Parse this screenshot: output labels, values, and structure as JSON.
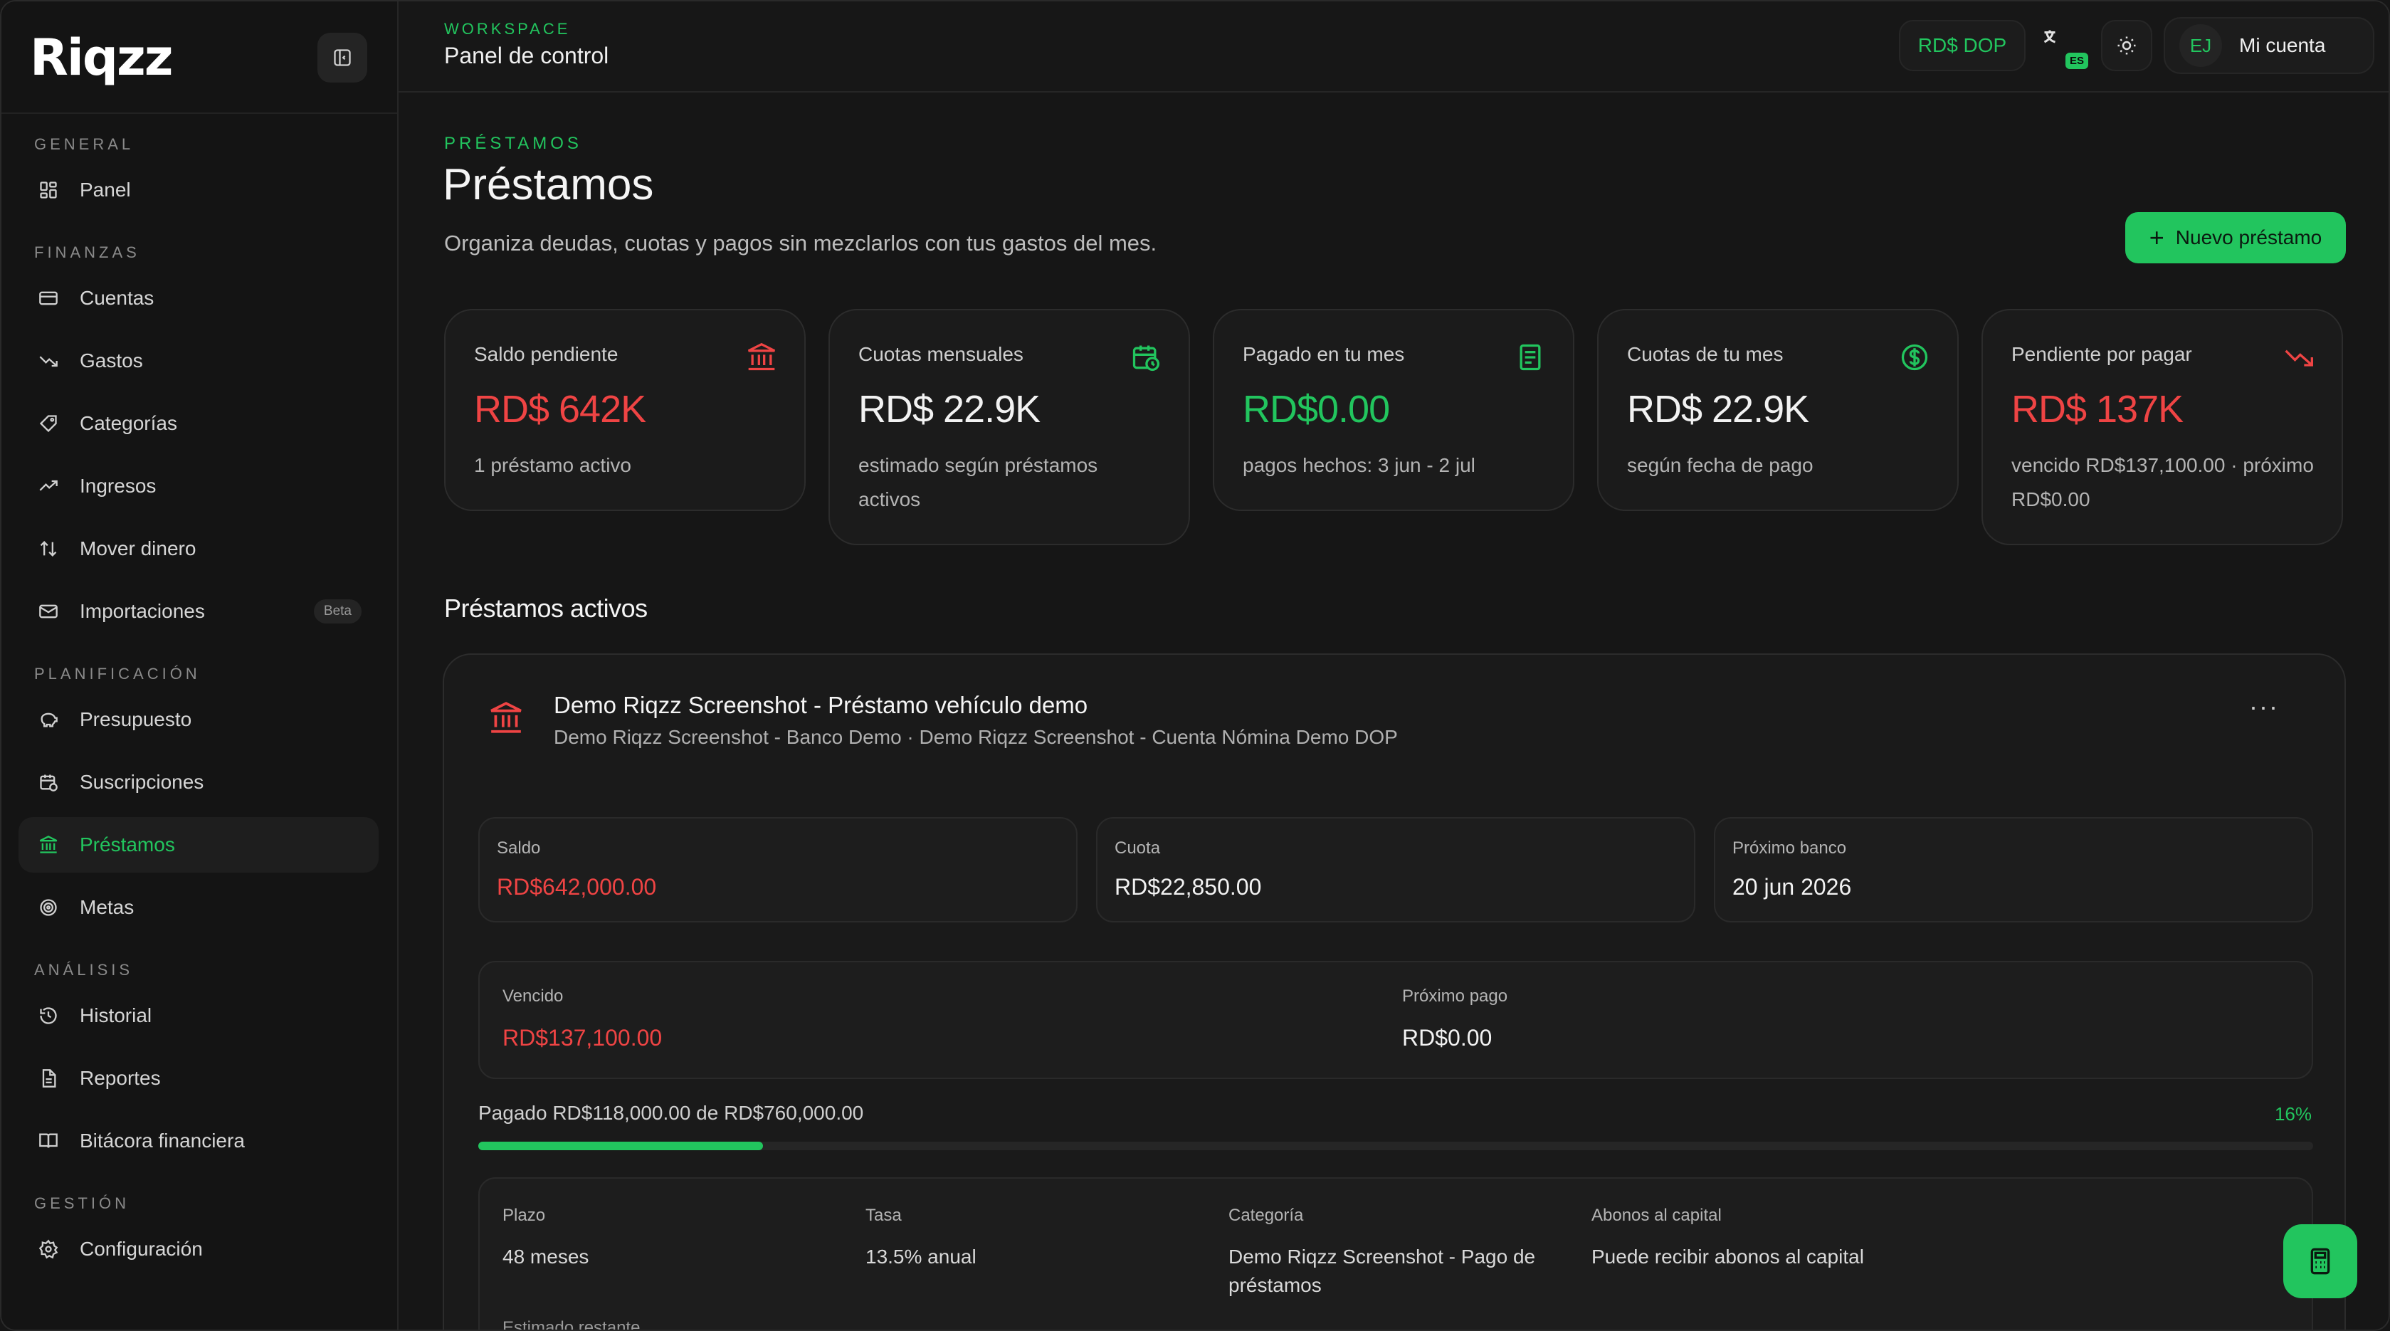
{
  "sidebar": {
    "logo": "Riqzz",
    "sections": {
      "general": "GENERAL",
      "finanzas": "FINANZAS",
      "planificacion": "PLANIFICACIÓN",
      "analisis": "ANÁLISIS",
      "gestion": "GESTIÓN"
    },
    "items": {
      "panel": "Panel",
      "cuentas": "Cuentas",
      "gastos": "Gastos",
      "categorias": "Categorías",
      "ingresos": "Ingresos",
      "mover": "Mover dinero",
      "importaciones": "Importaciones",
      "importaciones_badge": "Beta",
      "presupuesto": "Presupuesto",
      "suscripciones": "Suscripciones",
      "prestamos": "Préstamos",
      "metas": "Metas",
      "historial": "Historial",
      "reportes": "Reportes",
      "bitacora": "Bitácora financiera",
      "configuracion": "Configuración"
    },
    "active_item": "Préstamos"
  },
  "topbar": {
    "workspace_label": "WORKSPACE",
    "workspace_title": "Panel de control",
    "currency": "RD$ DOP",
    "language_badge": "ES",
    "avatar_initials": "EJ",
    "account_label": "Mi cuenta"
  },
  "page": {
    "kicker": "PRÉSTAMOS",
    "title": "Préstamos",
    "subtitle": "Organiza deudas, cuotas y pagos sin mezclarlos con tus gastos del mes.",
    "new_button": "Nuevo préstamo",
    "stats": [
      {
        "label": "Saldo pendiente",
        "value": "RD$ 642K",
        "sub": "1 préstamo activo",
        "icon": "bank-icon"
      },
      {
        "label": "Cuotas mensuales",
        "value": "RD$ 22.9K",
        "sub": "estimado según préstamos activos",
        "icon": "calendar-clock-icon"
      },
      {
        "label": "Pagado en tu mes",
        "value": "RD$0.00",
        "sub": "pagos hechos: 3 jun - 2 jul",
        "icon": "receipt-icon"
      },
      {
        "label": "Cuotas de tu mes",
        "value": "RD$ 22.9K",
        "sub": "según fecha de pago",
        "icon": "dollar-circle-icon"
      },
      {
        "label": "Pendiente por pagar",
        "value": "RD$ 137K",
        "sub": "vencido RD$137,100.00 · próximo RD$0.00",
        "icon": "trending-down-icon"
      }
    ],
    "section_title": "Préstamos activos",
    "loan": {
      "title": "Demo Riqzz Screenshot - Préstamo vehículo demo",
      "subtitle": "Demo Riqzz Screenshot - Banco Demo · Demo Riqzz Screenshot - Cuenta Nómina Demo DOP",
      "more": "···",
      "saldo_label": "Saldo",
      "saldo_value": "RD$642,000.00",
      "cuota_label": "Cuota",
      "cuota_value": "RD$22,850.00",
      "proximo_banco_label": "Próximo banco",
      "proximo_banco_value": "20 jun 2026",
      "vencido_label": "Vencido",
      "vencido_value": "RD$137,100.00",
      "proximo_pago_label": "Próximo pago",
      "proximo_pago_value": "RD$0.00",
      "progress_label": "Pagado RD$118,000.00 de RD$760,000.00",
      "progress_pct": "16%",
      "progress_fraction": 0.155,
      "plazo_label": "Plazo",
      "plazo_value": "48 meses",
      "tasa_label": "Tasa",
      "tasa_value": "13.5% anual",
      "categoria_label": "Categoría",
      "categoria_value": "Demo Riqzz Screenshot - Pago de préstamos",
      "abonos_label": "Abonos al capital",
      "abonos_value": "Puede recibir abonos al capital",
      "estimado_label": "Estimado restante"
    }
  },
  "colors": {
    "accent": "#22c55e",
    "danger": "#ef4444",
    "background": "#161616"
  }
}
